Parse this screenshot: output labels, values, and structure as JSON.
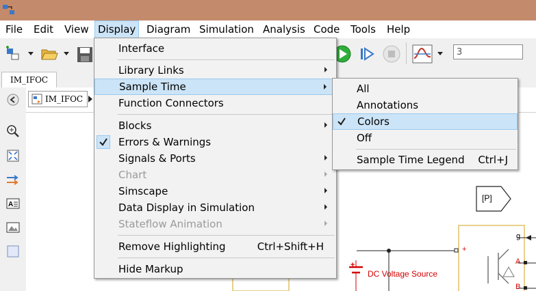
{
  "menubar": {
    "items": [
      "File",
      "Edit",
      "View",
      "Display",
      "Diagram",
      "Simulation",
      "Analysis",
      "Code",
      "Tools",
      "Help"
    ]
  },
  "toolbar": {
    "stop_time": "3"
  },
  "tabs": {
    "model_tab": "IM_IFOC"
  },
  "breadcrumb": {
    "model": "IM_IFOC"
  },
  "display_menu": {
    "items": [
      {
        "label": "Interface"
      },
      {
        "label": "Library Links"
      },
      {
        "label": "Sample Time"
      },
      {
        "label": "Function Connectors"
      },
      {
        "label": "Blocks"
      },
      {
        "label": "Errors & Warnings"
      },
      {
        "label": "Signals & Ports"
      },
      {
        "label": "Chart"
      },
      {
        "label": "Simscape"
      },
      {
        "label": "Data Display in Simulation"
      },
      {
        "label": "Stateflow Animation"
      },
      {
        "label": "Remove Highlighting",
        "shortcut": "Ctrl+Shift+H"
      },
      {
        "label": "Hide Markup"
      }
    ]
  },
  "sample_time_menu": {
    "items": [
      {
        "label": "All"
      },
      {
        "label": "Annotations"
      },
      {
        "label": "Colors"
      },
      {
        "label": "Off"
      },
      {
        "label": "Sample Time Legend",
        "shortcut": "Ctrl+J"
      }
    ]
  },
  "canvas": {
    "goto_tag": "[P]",
    "dc_source_label": "DC Voltage Source",
    "port_g": "g",
    "port_a": "A",
    "port_b": "B",
    "plus_sign": "+"
  },
  "colors": {
    "title_bar": "#c48a6c",
    "menu_highlight": "#cce4f7",
    "source_red": "#d40000",
    "block_border": "#e8d08a"
  }
}
